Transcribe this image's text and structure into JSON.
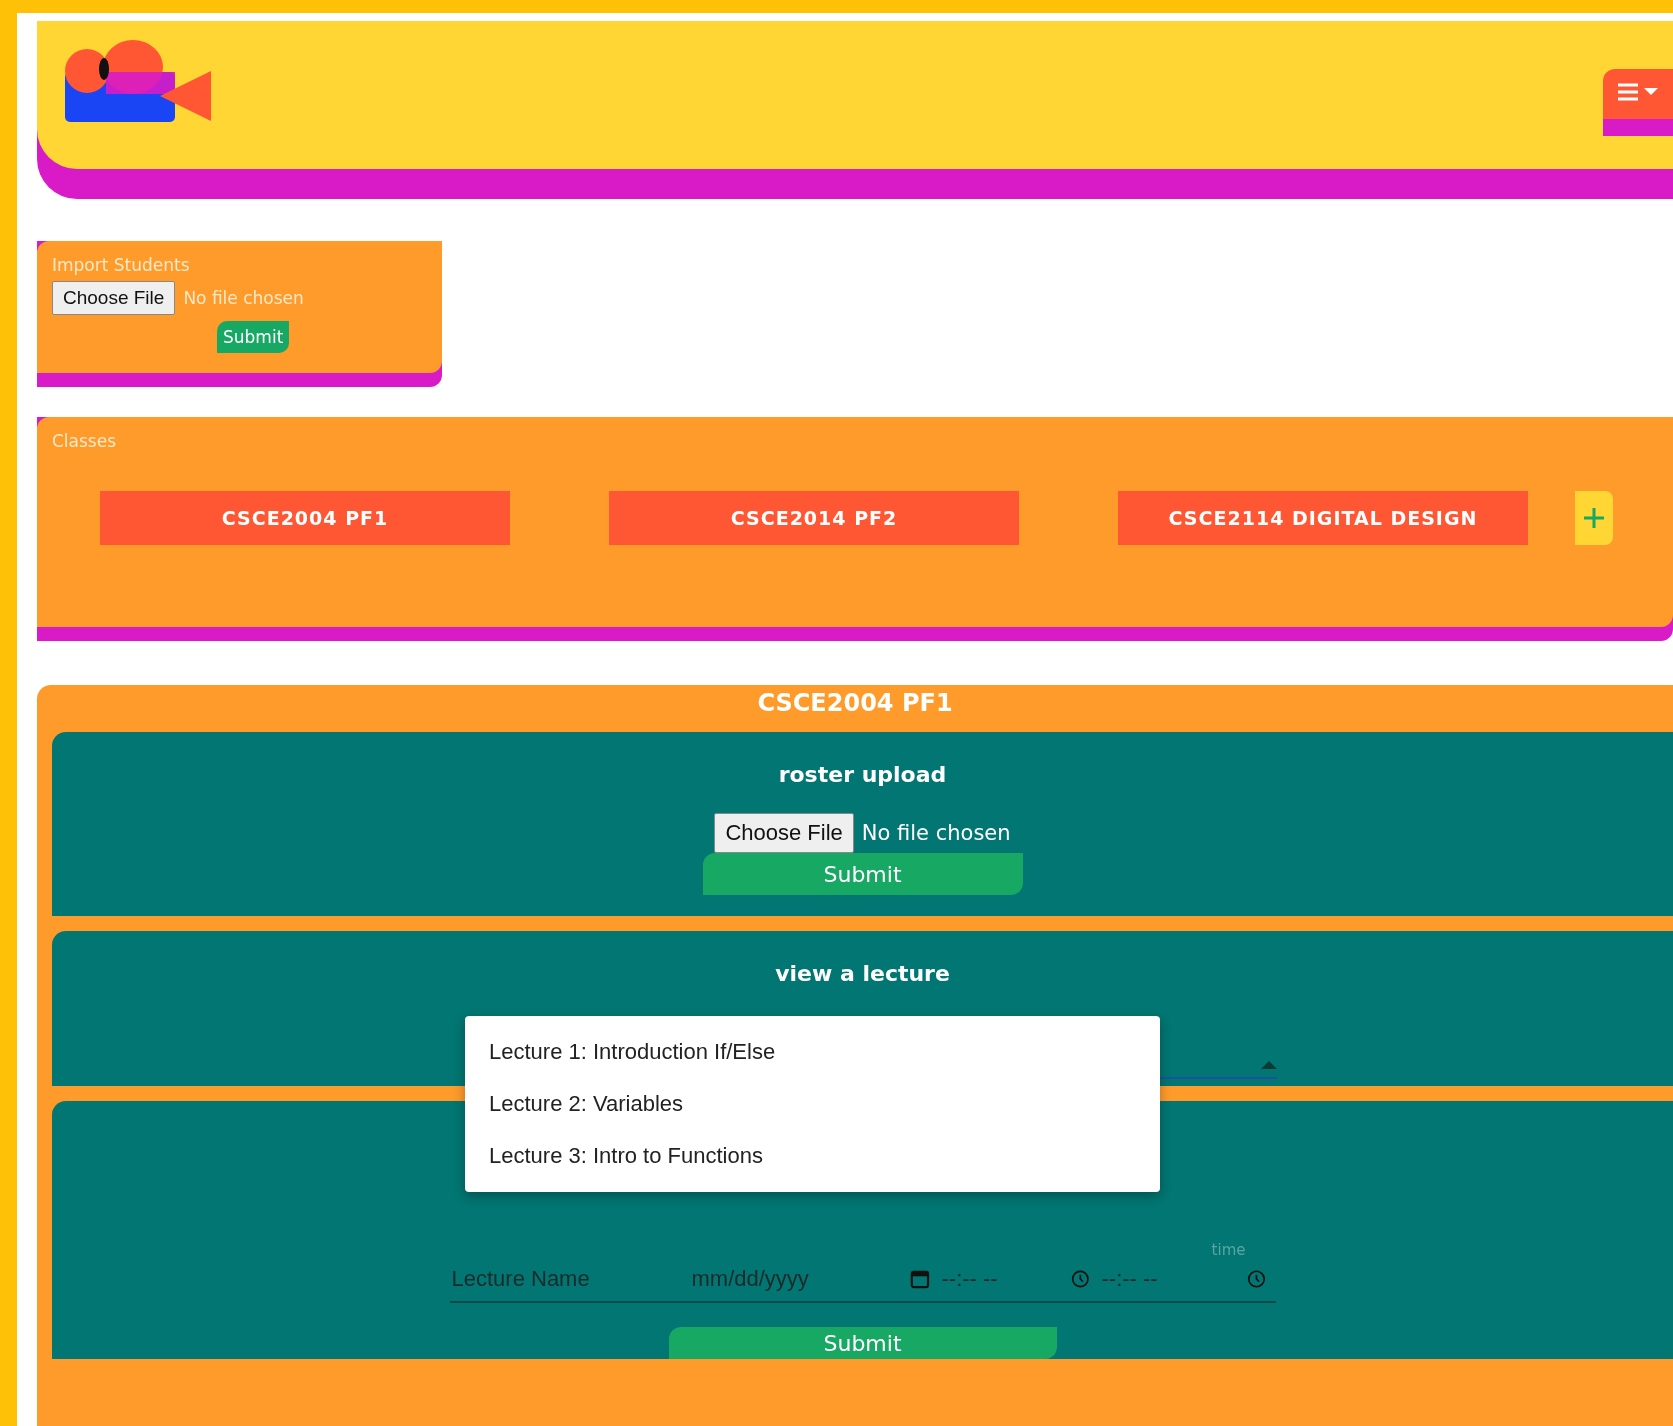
{
  "import_students": {
    "title": "Import Students",
    "file_button": "Choose File",
    "file_status": "No file chosen",
    "submit": "Submit"
  },
  "classes": {
    "title": "Classes",
    "items": [
      {
        "label": "CSCE2004 PF1"
      },
      {
        "label": "CSCE2014 PF2"
      },
      {
        "label": "CSCE2114 DIGITAL DESIGN"
      }
    ]
  },
  "course": {
    "title": "CSCE2004 PF1",
    "roster_upload": {
      "title": "roster upload",
      "file_button": "Choose File",
      "file_status": "No file chosen",
      "submit": "Submit"
    },
    "view_lecture": {
      "title": "view a lecture",
      "dropdown": {
        "expanded": true,
        "options": [
          {
            "label": "Lecture 1: Introduction If/Else"
          },
          {
            "label": "Lecture 2: Variables"
          },
          {
            "label": "Lecture 3: Intro to Functions"
          }
        ]
      }
    },
    "new_lecture": {
      "fields": [
        {
          "kind": "text",
          "placeholder": "Lecture Name"
        },
        {
          "kind": "date",
          "placeholder": "mm/dd/yyyy"
        },
        {
          "kind": "time",
          "placeholder": "--:-- --"
        },
        {
          "kind": "time",
          "label": "time",
          "placeholder": "--:-- --"
        }
      ],
      "submit": "Submit"
    }
  }
}
